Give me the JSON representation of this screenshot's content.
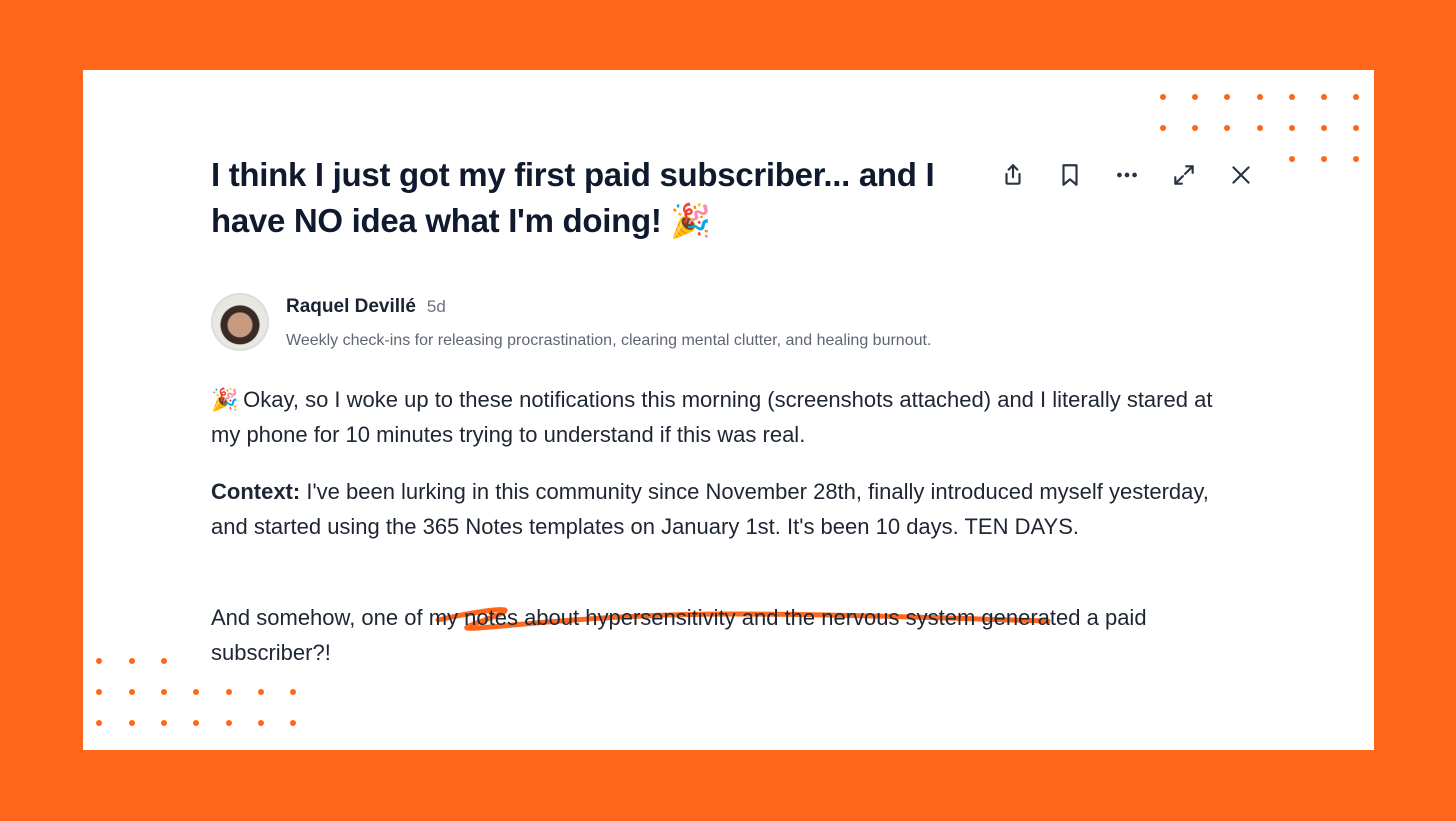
{
  "post": {
    "title": "I think I just got my first paid subscriber... and I have NO idea what I'm doing! 🎉",
    "author": {
      "name": "Raquel Devillé",
      "time": "5d",
      "bio": "Weekly check-ins for releasing procrastination, clearing mental clutter, and healing burnout."
    },
    "paragraphs": {
      "p1_emoji": "🎉",
      "p1": "Okay, so I woke up to these notifications this morning (screenshots attached) and I literally stared at my phone for 10 minutes trying to understand if this was real.",
      "p2_label": "Context:",
      "p2": " I've been lurking in this community since November 28th, finally introduced myself yesterday, and started using the 365 Notes templates on January 1st. It's been 10 days. TEN DAYS.",
      "p3": "And somehow, one of my notes about hypersensitivity and the nervous system generated a paid subscriber?!"
    }
  },
  "toolbar": {
    "icons": [
      "share-icon",
      "bookmark-icon",
      "more-icon",
      "expand-icon",
      "close-icon"
    ]
  },
  "colors": {
    "accent": "#ff671d",
    "text": "#1e2633",
    "muted": "#5f6673"
  }
}
